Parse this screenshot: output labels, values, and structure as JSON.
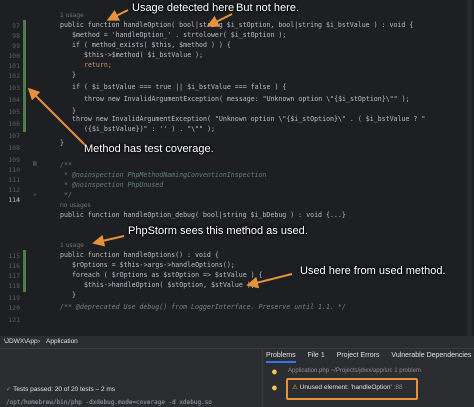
{
  "annotations": {
    "usage_detected": "Usage detected here",
    "but_not_here": "But not here.",
    "test_coverage": "Method has test coverage.",
    "phpstorm_sees": "PhpStorm sees this method as used.",
    "used_here": "Used here from used method."
  },
  "gutter": {
    "line_numbers": [
      "97",
      "98",
      "99",
      "100",
      "101",
      "102",
      "103",
      "104",
      "105",
      "106",
      "107",
      "108",
      "109",
      "110",
      "111",
      "112",
      "113",
      "114",
      "",
      "",
      "115",
      "116",
      "117",
      "118",
      "119",
      "120",
      "121",
      "122",
      "123"
    ],
    "current_line": "114"
  },
  "code": {
    "hint_usage_1": "1 usage",
    "line_handle_option_decl": "public function handleOption( bool|string $i_stOption, bool|string $i_bstValue ) : void {",
    "line_method_assign": "$method = 'handleOption_' . strtolower( $i_stOption );",
    "line_if_method_exists": "if ( method_exists( $this, $method ) ) {",
    "line_this_method": "$this->$method( $i_bstValue );",
    "line_return": "return;",
    "line_close_1": "}",
    "line_if_true": "if ( $i_bstValue === true || $i_bstValue === false ) {",
    "line_throw_1": "throw new InvalidArgumentException( message: \"Unknown option \\\"{$i_stOption}\\\"\" );",
    "line_close_2": "}",
    "line_throw_2": "throw new InvalidArgumentException( \"Unknown option \\\"{$i_stOption}\\\" . ( $i_bstValue ? \"",
    "line_throw_2b": "({$i_bstValue})\" : '' ) . \"\\\"\" );",
    "line_close_3": "}",
    "line_doc_open": "/**",
    "line_doc_1": "* @noinspection PhpMethodNamingConventionInspection",
    "line_doc_2": "* @noinspection PhpUnused",
    "line_doc_close": "*/",
    "hint_no_usages": "no usages",
    "line_debug_decl": "public function handleOption_debug( bool|string $i_bDebug ) : void {...}",
    "hint_usage_2": "1 usage",
    "line_handle_options_decl": "public function handleOptions() : void {",
    "line_r_options": "$rOptions = $this->args->handleOptions();",
    "line_foreach": "foreach ( $rOptions as $stOption => $stValue ) {",
    "line_this_handle": "$this->handleOption( $stOption, $stValue );",
    "line_close_4": "}",
    "line_deprecated": "/** @deprecated Use debug() from LoggerInterface. Preserve until 1.1. */",
    "chip_message": "message:"
  },
  "breadcrumb": {
    "namespace": "\\JDWX\\App",
    "separator": "›",
    "class": "Application"
  },
  "bottom_panel": {
    "tabs": [
      "Problems",
      "File",
      "1",
      "Project Errors",
      "Vulnerable Dependencies"
    ],
    "tests_passed": "Tests passed: 20 of 20 tests – 2 ms",
    "console_line": "/opt/homebrew/bin/php -dxdebug.mode=coverage -d xdebug.so",
    "problem_file": "Application.php  ~/Projects/jdwx/app/src  1 problem",
    "problem_text": "Unused element: 'handleOption'",
    "problem_loc": ":88"
  },
  "colors": {
    "accent_orange": "#e79238",
    "coverage_green": "#4f7a4b",
    "active_tab": "#3574f0"
  }
}
